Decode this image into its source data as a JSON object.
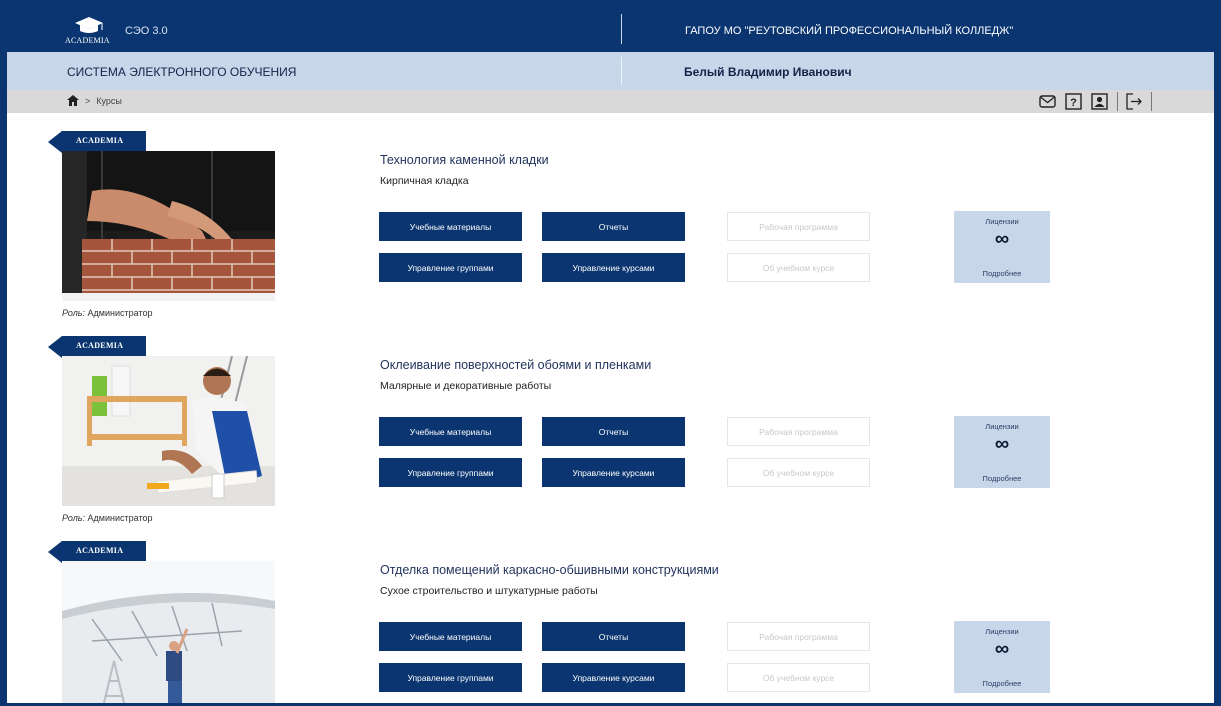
{
  "header": {
    "logo_text": "ACADEMIA",
    "system_name": "СЭО 3.0",
    "organization": "ГАПОУ МО \"РЕУТОВСКИЙ ПРОФЕССИОНАЛЬНЫЙ КОЛЛЕДЖ\""
  },
  "subheader": {
    "title": "СИСТЕМА ЭЛЕКТРОННОГО ОБУЧЕНИЯ",
    "user": "Белый Владимир Иванович"
  },
  "breadcrumb": {
    "home_icon": "home-icon",
    "separator": ">",
    "current": "Курсы"
  },
  "toolbar": {
    "icons": [
      "mail-icon",
      "help-icon",
      "profile-icon",
      "logout-icon"
    ],
    "help_glyph": "?"
  },
  "ribbon_text": "ACADEMIA",
  "courses": [
    {
      "title": "Технология каменной кладки",
      "subtitle": "Кирпичная кладка",
      "role_label": "Роль:",
      "role_value": "Администратор",
      "buttons": {
        "materials": "Учебные материалы",
        "reports": "Отчеты",
        "groups": "Управление группами",
        "courses": "Управление курсами",
        "program": "Рабочая программа",
        "about": "Об учебном курсе"
      },
      "license": {
        "title": "Лицензии",
        "value": "∞",
        "more": "Подробнее"
      }
    },
    {
      "title": "Оклеивание поверхностей обоями и пленками",
      "subtitle": "Малярные и декоративные работы",
      "role_label": "Роль:",
      "role_value": "Администратор",
      "buttons": {
        "materials": "Учебные материалы",
        "reports": "Отчеты",
        "groups": "Управление группами",
        "courses": "Управление курсами",
        "program": "Рабочая программа",
        "about": "Об учебном курсе"
      },
      "license": {
        "title": "Лицензии",
        "value": "∞",
        "more": "Подробнее"
      }
    },
    {
      "title": "Отделка помещений каркасно-обшивными конструкциями",
      "subtitle": "Сухое строительство и штукатурные работы",
      "buttons": {
        "materials": "Учебные материалы",
        "reports": "Отчеты",
        "groups": "Управление группами",
        "courses": "Управление курсами",
        "program": "Рабочая программа",
        "about": "Об учебном курсе"
      },
      "license": {
        "title": "Лицензии",
        "value": "∞",
        "more": "Подробнее"
      }
    }
  ],
  "colors": {
    "primary": "#0a3570",
    "subbar": "#c8d6ea",
    "crumbbar": "#d9d9d9"
  }
}
